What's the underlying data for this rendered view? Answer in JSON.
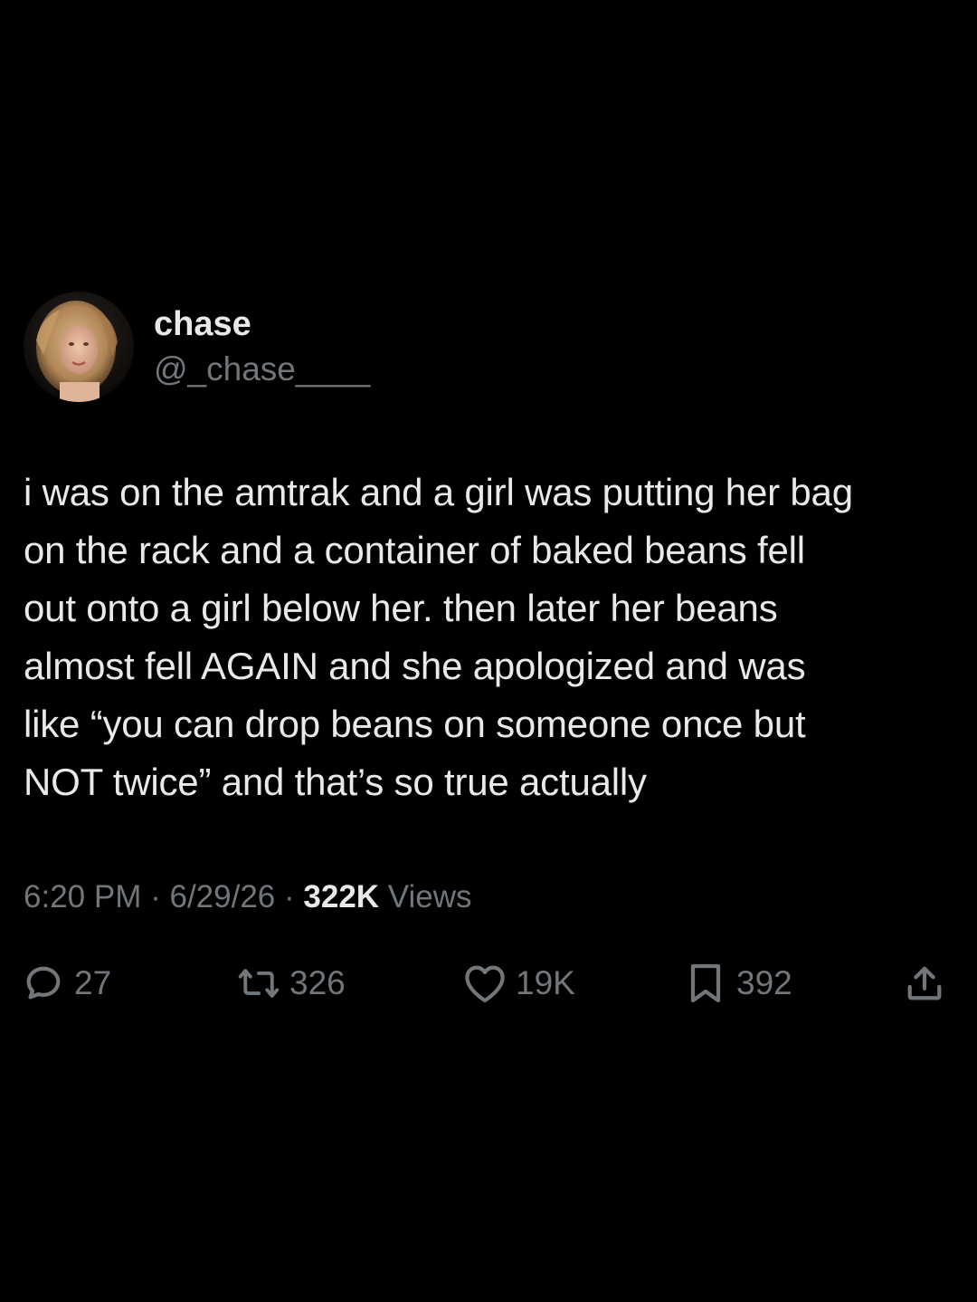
{
  "author": {
    "display_name": "chase",
    "handle": "@_chase____"
  },
  "tweet": {
    "text": "i was on the amtrak and a girl was putting her bag\non the rack and a container of baked beans fell\nout onto a girl below her. then later her beans\nalmost fell AGAIN and she apologized and was\nlike “you can drop beans on someone once but\nNOT twice” and that’s so true actually",
    "time": "6:20 PM",
    "date": "6/29/26",
    "separator": "·",
    "views_count": "322K",
    "views_label": "Views"
  },
  "actions": {
    "replies": "27",
    "retweets": "326",
    "likes": "19K",
    "bookmarks": "392"
  },
  "icons": {
    "reply": "speech-bubble-icon",
    "retweet": "retweet-arrows-icon",
    "like": "heart-icon",
    "bookmark": "bookmark-icon",
    "share": "share-upload-icon"
  },
  "colors": {
    "background": "#000000",
    "primary_text": "#e7e9ea",
    "secondary_text": "#71767b"
  }
}
